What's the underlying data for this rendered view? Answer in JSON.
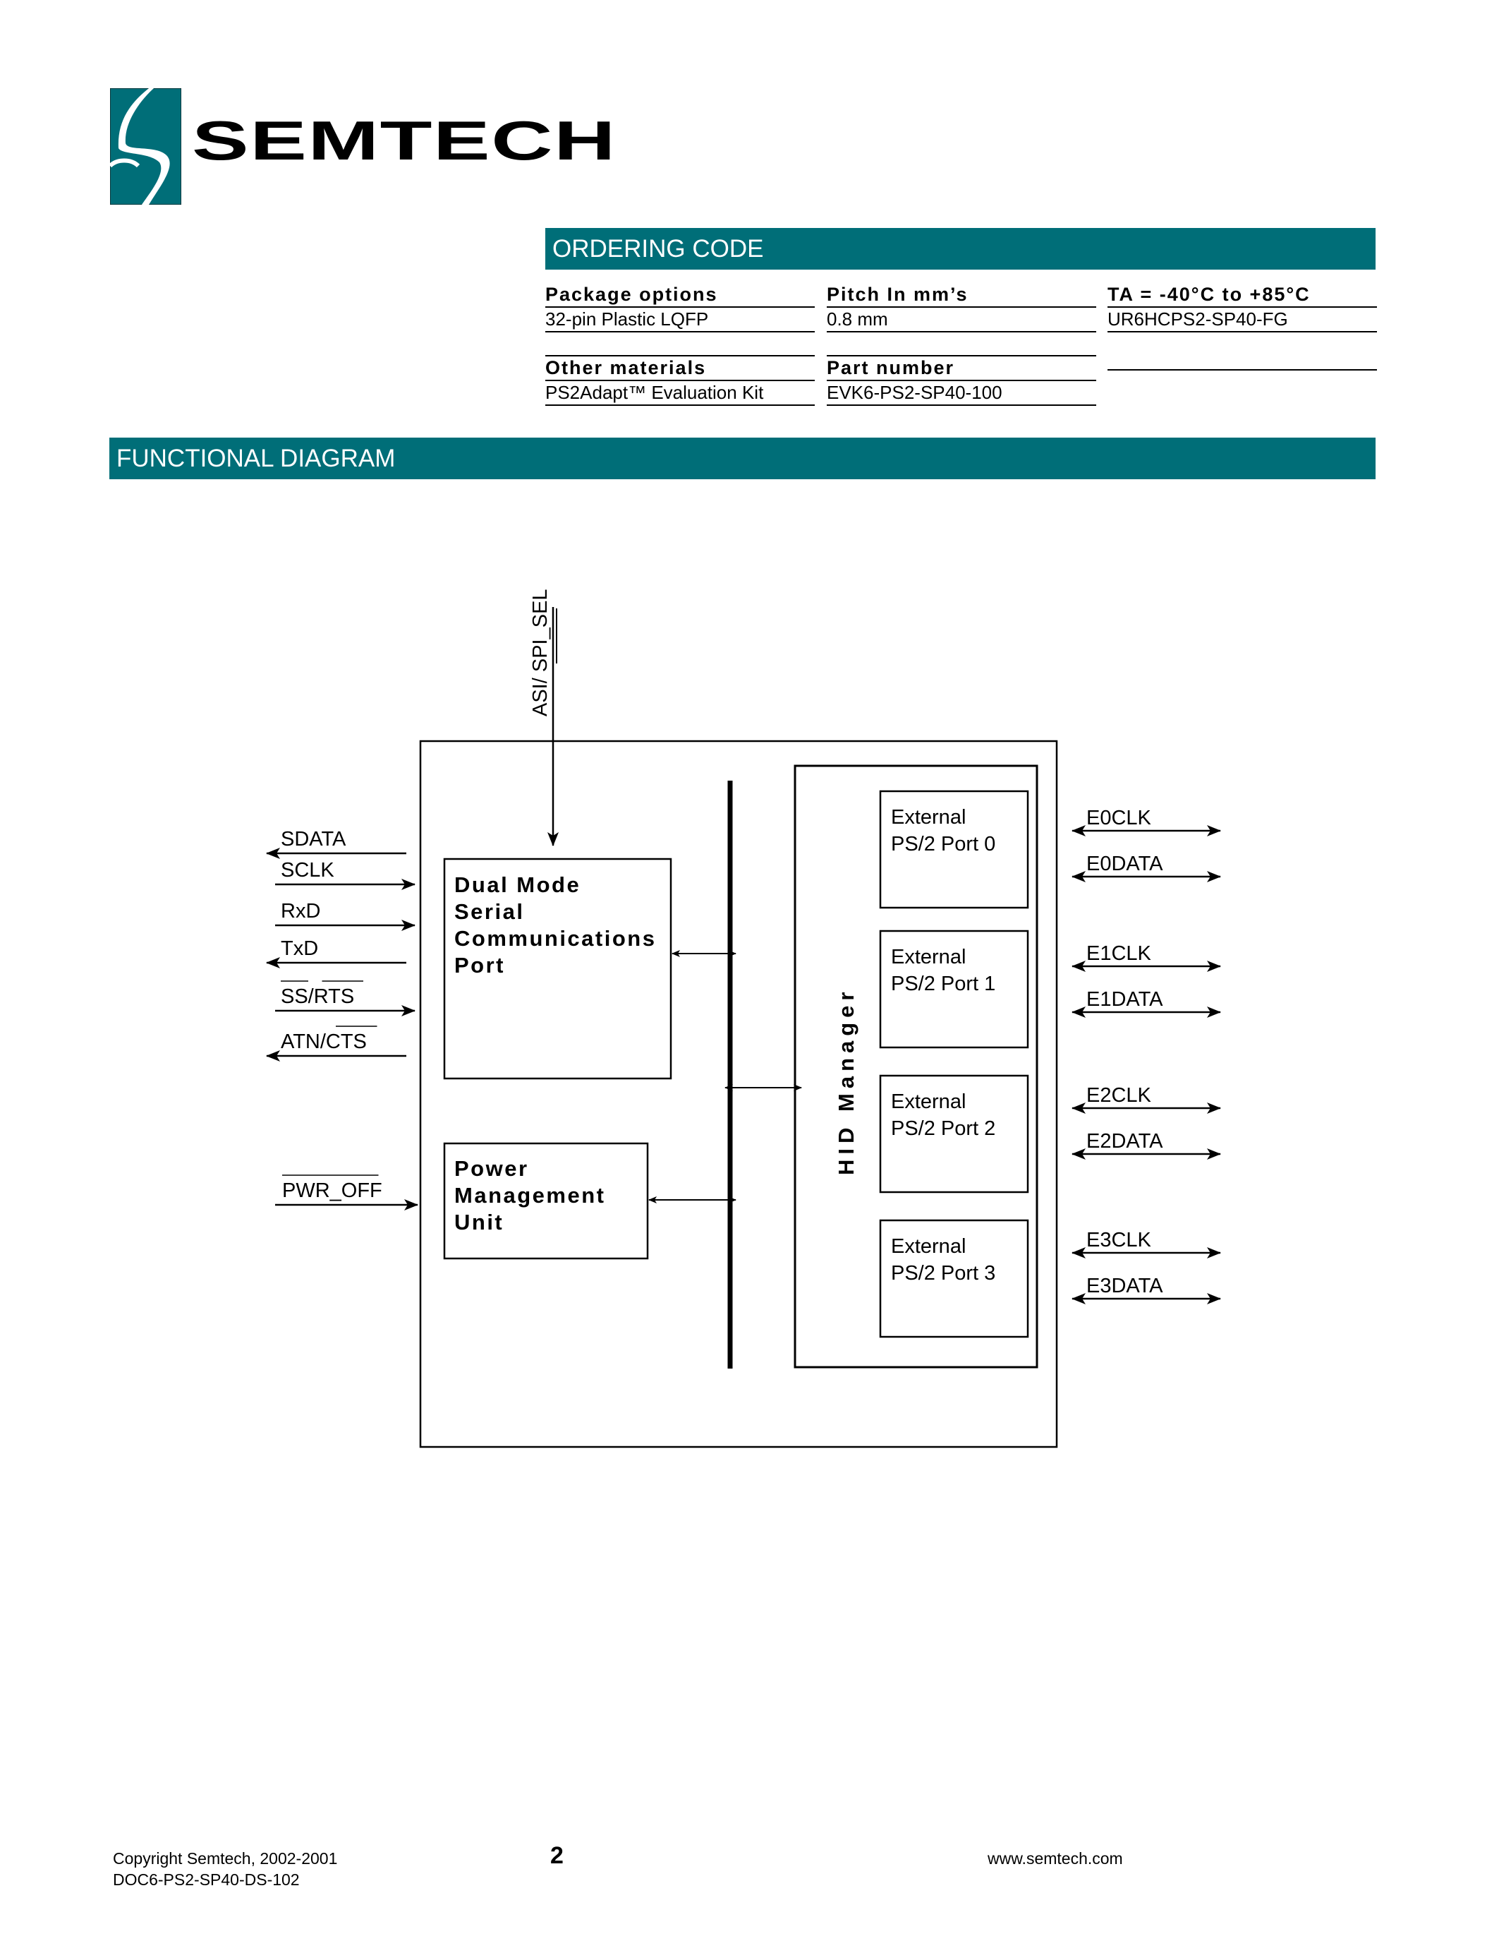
{
  "brand": {
    "logo_icon": "semtech-s-icon",
    "name": "SEMTECH",
    "brand_color": "#006e78"
  },
  "ordering_code": {
    "title": "ORDERING CODE",
    "columns": [
      {
        "header": "Package options",
        "value": "32-pin Plastic LQFP"
      },
      {
        "header": "Pitch In mm’s",
        "value": "0.8 mm"
      },
      {
        "header": "TA = -40°C to +85°C",
        "value": "UR6HCPS2-SP40-FG"
      }
    ],
    "other": [
      {
        "header": "Other materials",
        "value": "PS2Adapt™ Evaluation Kit"
      },
      {
        "header": "Part number",
        "value": "EVK6-PS2-SP40-100"
      }
    ]
  },
  "functional_diagram": {
    "title": "FUNCTIONAL DIAGRAM",
    "top_signal": "ASI/ SPI_SEL",
    "left_signals": [
      {
        "label": "SDATA",
        "direction": "out"
      },
      {
        "label": "SCLK",
        "direction": "in"
      },
      {
        "label": "RxD",
        "direction": "in"
      },
      {
        "label": "TxD",
        "direction": "out"
      },
      {
        "label": "SS/RTS",
        "direction": "in"
      },
      {
        "label": "ATN/CTS",
        "direction": "out"
      },
      {
        "label": "PWR_OFF",
        "direction": "in"
      }
    ],
    "blocks": {
      "serial": [
        "Dual Mode",
        "Serial",
        "Communications",
        "Port"
      ],
      "power": [
        "Power",
        "Management",
        "Unit"
      ],
      "hid": "HID Manager"
    },
    "ports": [
      {
        "line1": "External",
        "line2": "PS/2 Port 0",
        "clk": "E0CLK",
        "data": "E0DATA"
      },
      {
        "line1": "External",
        "line2": "PS/2 Port 1",
        "clk": "E1CLK",
        "data": "E1DATA"
      },
      {
        "line1": "External",
        "line2": "PS/2 Port 2",
        "clk": "E2CLK",
        "data": "E2DATA"
      },
      {
        "line1": "External",
        "line2": "PS/2 Port 3",
        "clk": "E3CLK",
        "data": "E3DATA"
      }
    ]
  },
  "footer": {
    "copyright": "Copyright Semtech, 2002-2001",
    "doc_id": "DOC6-PS2-SP40-DS-102",
    "page": "2",
    "website": "www.semtech.com"
  }
}
